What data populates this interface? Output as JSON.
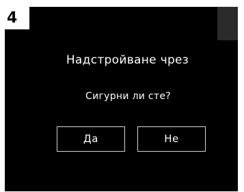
{
  "step": {
    "number": "4"
  },
  "dialog": {
    "title": "Надстройване чрез",
    "question": "Сигурни ли сте?",
    "yes_label": "Да",
    "no_label": "Не"
  },
  "colors": {
    "screen_background": "#000000",
    "text": "#ffffff",
    "button_border": "#d8d8d8",
    "badge_background": "#ffffff",
    "corner_block": "#2b2b2b"
  }
}
